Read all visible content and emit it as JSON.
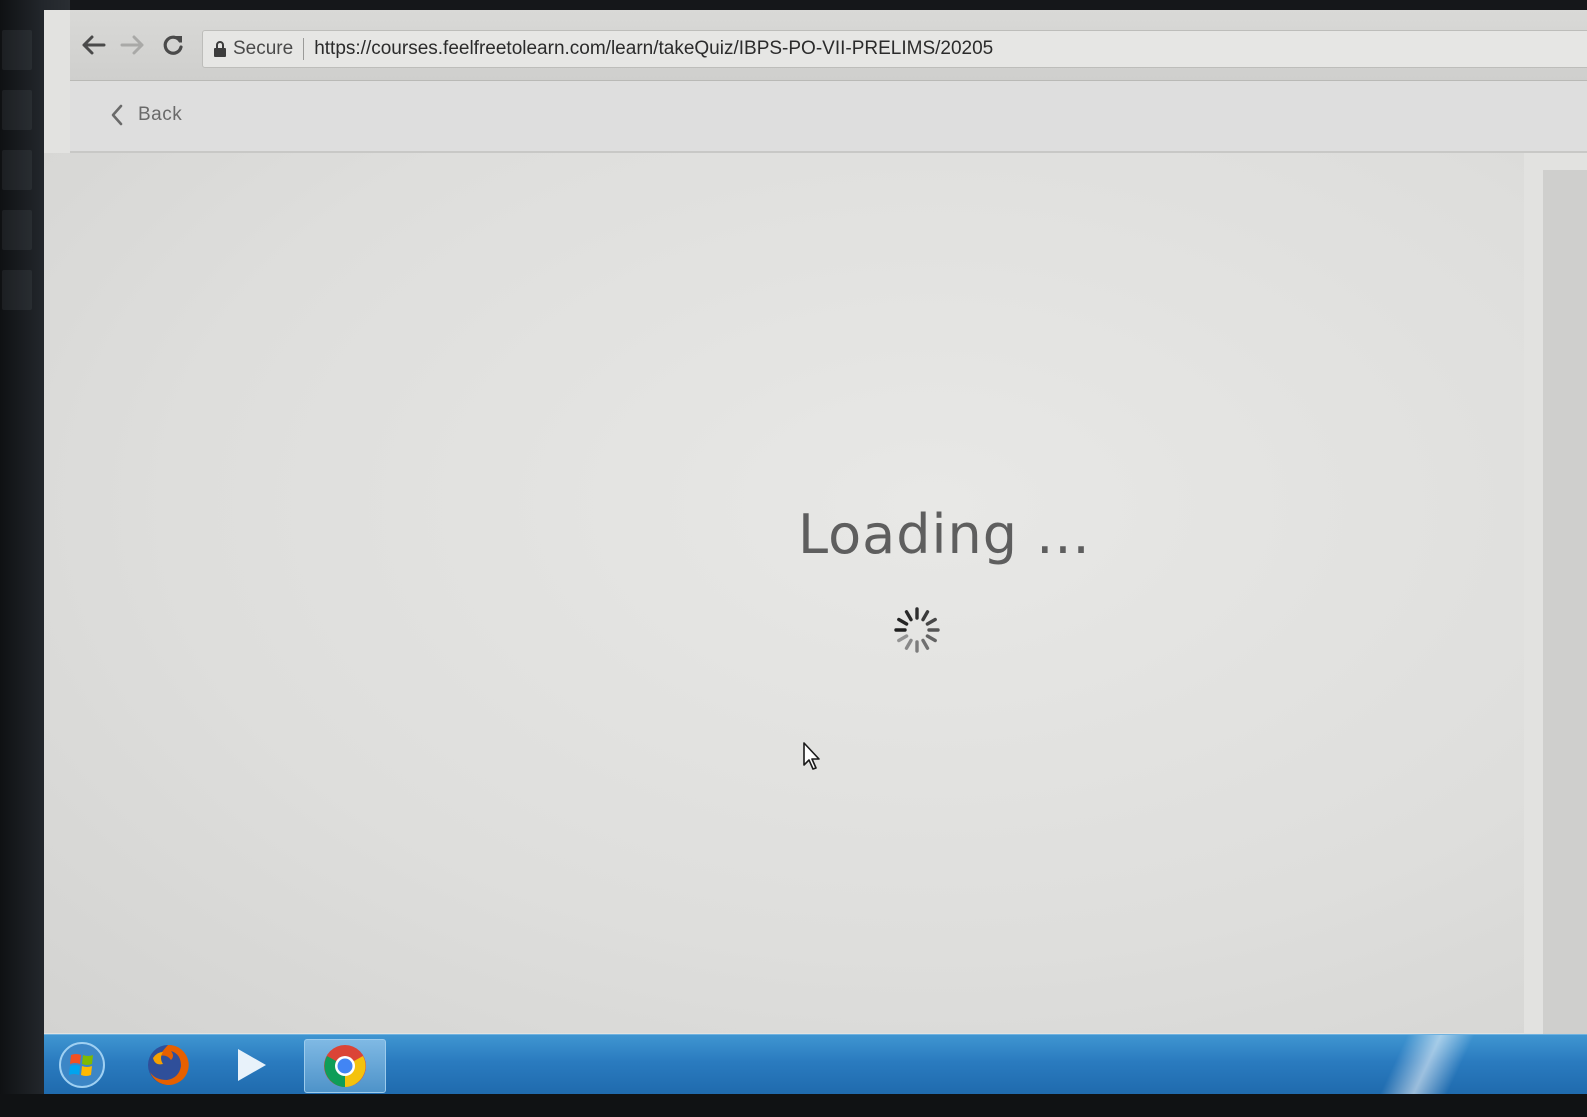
{
  "browser": {
    "secure_label": "Secure",
    "url": "https://courses.feelfreetolearn.com/learn/takeQuiz/IBPS-PO-VII-PRELIMS/20205",
    "icons": {
      "back": "arrow-left-icon",
      "forward": "arrow-right-icon",
      "reload": "reload-icon",
      "lock": "lock-icon"
    }
  },
  "page": {
    "back_label": "Back",
    "loading_text": "Loading ..."
  },
  "taskbar": {
    "items": [
      {
        "name": "start-button",
        "icon": "windows-logo-icon"
      },
      {
        "name": "firefox",
        "icon": "firefox-icon"
      },
      {
        "name": "media-player",
        "icon": "play-icon"
      },
      {
        "name": "chrome",
        "icon": "chrome-icon",
        "active": true
      }
    ]
  },
  "colors": {
    "taskbar": "#2a7bbf",
    "page_background": "#e2e2e0",
    "loading_text": "#5e5e5e"
  }
}
